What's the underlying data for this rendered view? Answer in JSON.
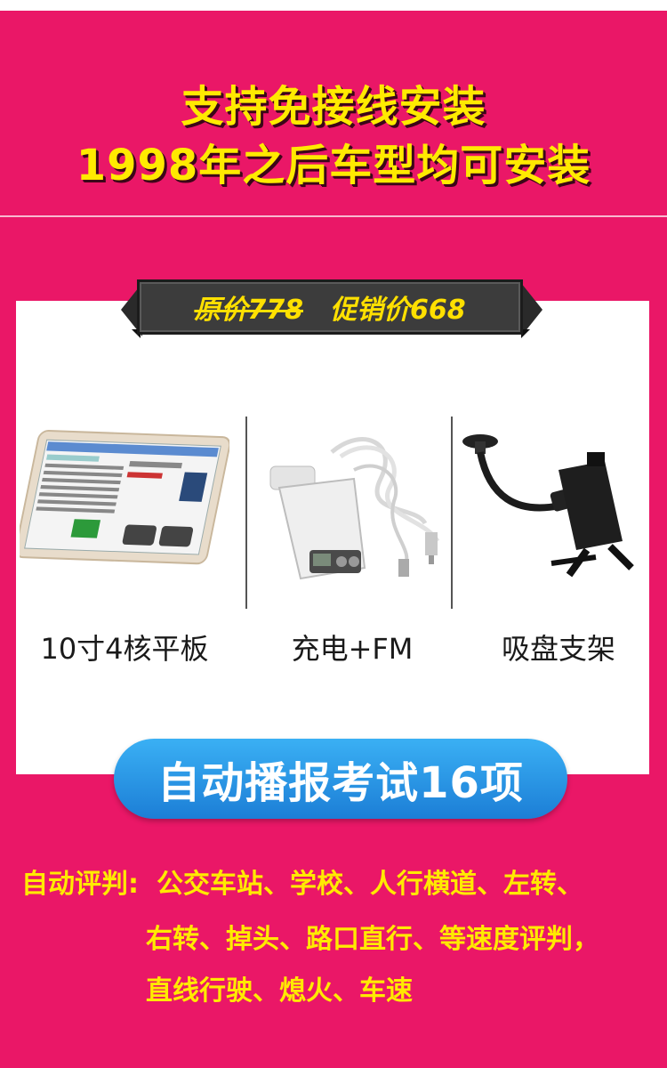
{
  "header": {
    "line1": "支持免接线安装",
    "line2": "1998年之后车型均可安装"
  },
  "price": {
    "original": "原价778",
    "sale": "促销价668"
  },
  "products": [
    {
      "label": "10寸4核平板",
      "icon": "tablet-image"
    },
    {
      "label": "充电+FM",
      "icon": "car-charger-fm-image"
    },
    {
      "label": "吸盘支架",
      "icon": "suction-mount-image"
    }
  ],
  "pill": {
    "text": "自动播报考试16项"
  },
  "features": {
    "label": "自动评判:",
    "line1": "公交车站、学校、人行横道、左转、",
    "line2": "右转、掉头、路口直行、等速度评判，",
    "line3": "直线行驶、熄火、车速"
  },
  "colors": {
    "background": "#ea1767",
    "headline": "#ffea00",
    "pill": "#1c7ed6",
    "ribbon": "#3c3c3c"
  }
}
